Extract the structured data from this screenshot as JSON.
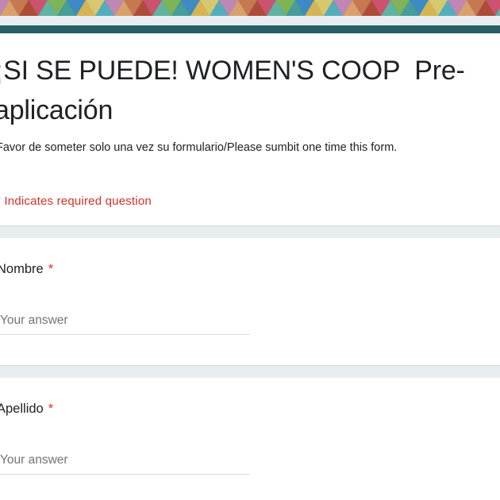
{
  "header": {
    "banner_colors": [
      "#e07a4b",
      "#f2c14e",
      "#e84e6f",
      "#5bb8c9",
      "#8cc152",
      "#f6a96b",
      "#3f8fd2",
      "#c4472e",
      "#f5d76e",
      "#69c0a8",
      "#d98bbf",
      "#4aa6a1"
    ]
  },
  "form": {
    "title": "¡SI SE PUEDE! WOMEN'S COOP  Pre-aplicación",
    "description": "Favor de someter solo una vez su formulario/Please sumbit one time this form.",
    "required_note": "* Indicates required question"
  },
  "questions": [
    {
      "label": "Nombre",
      "required_mark": "*",
      "placeholder": "Your answer"
    },
    {
      "label": "Apellido",
      "required_mark": "*",
      "placeholder": "Your answer"
    }
  ],
  "colors": {
    "accent": "#2a5f66",
    "required": "#d93025"
  }
}
